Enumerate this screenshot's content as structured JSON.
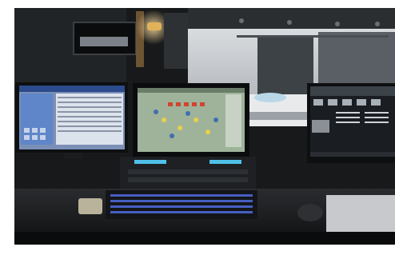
{
  "photo": {
    "subject": "lighting-control-desk",
    "colors": {
      "background": "#ffffff",
      "room": "#17191b",
      "stage_wall": "#c9ccd0",
      "stage_glow": "#e8eaec",
      "screen_blue": "#5f86c8",
      "screen_green": "#9fb39a",
      "screen_dark": "#1a1e22",
      "keyboard_led": "#4f6de0",
      "console_cyan": "#4fc0e8",
      "lamp_warm": "#e2b25a"
    }
  }
}
